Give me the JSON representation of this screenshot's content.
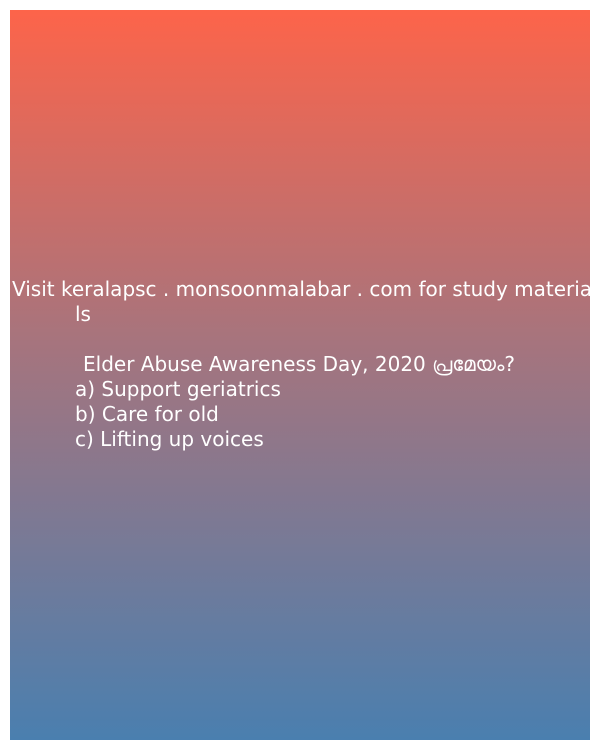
{
  "promo": {
    "line1": "Visit keralapsc . monsoonmalabar . com for study materia",
    "line2": "ls"
  },
  "quiz": {
    "question": "Elder Abuse Awareness Day, 2020 പ്രമേയം?",
    "options": [
      "a) Support geriatrics",
      "b) Care for old",
      "c) Lifting up voices"
    ]
  },
  "colors": {
    "gradient_top": "#fd644a",
    "gradient_middle": "#a7747d",
    "gradient_bottom": "#4a7faf",
    "text": "#ffffff"
  }
}
